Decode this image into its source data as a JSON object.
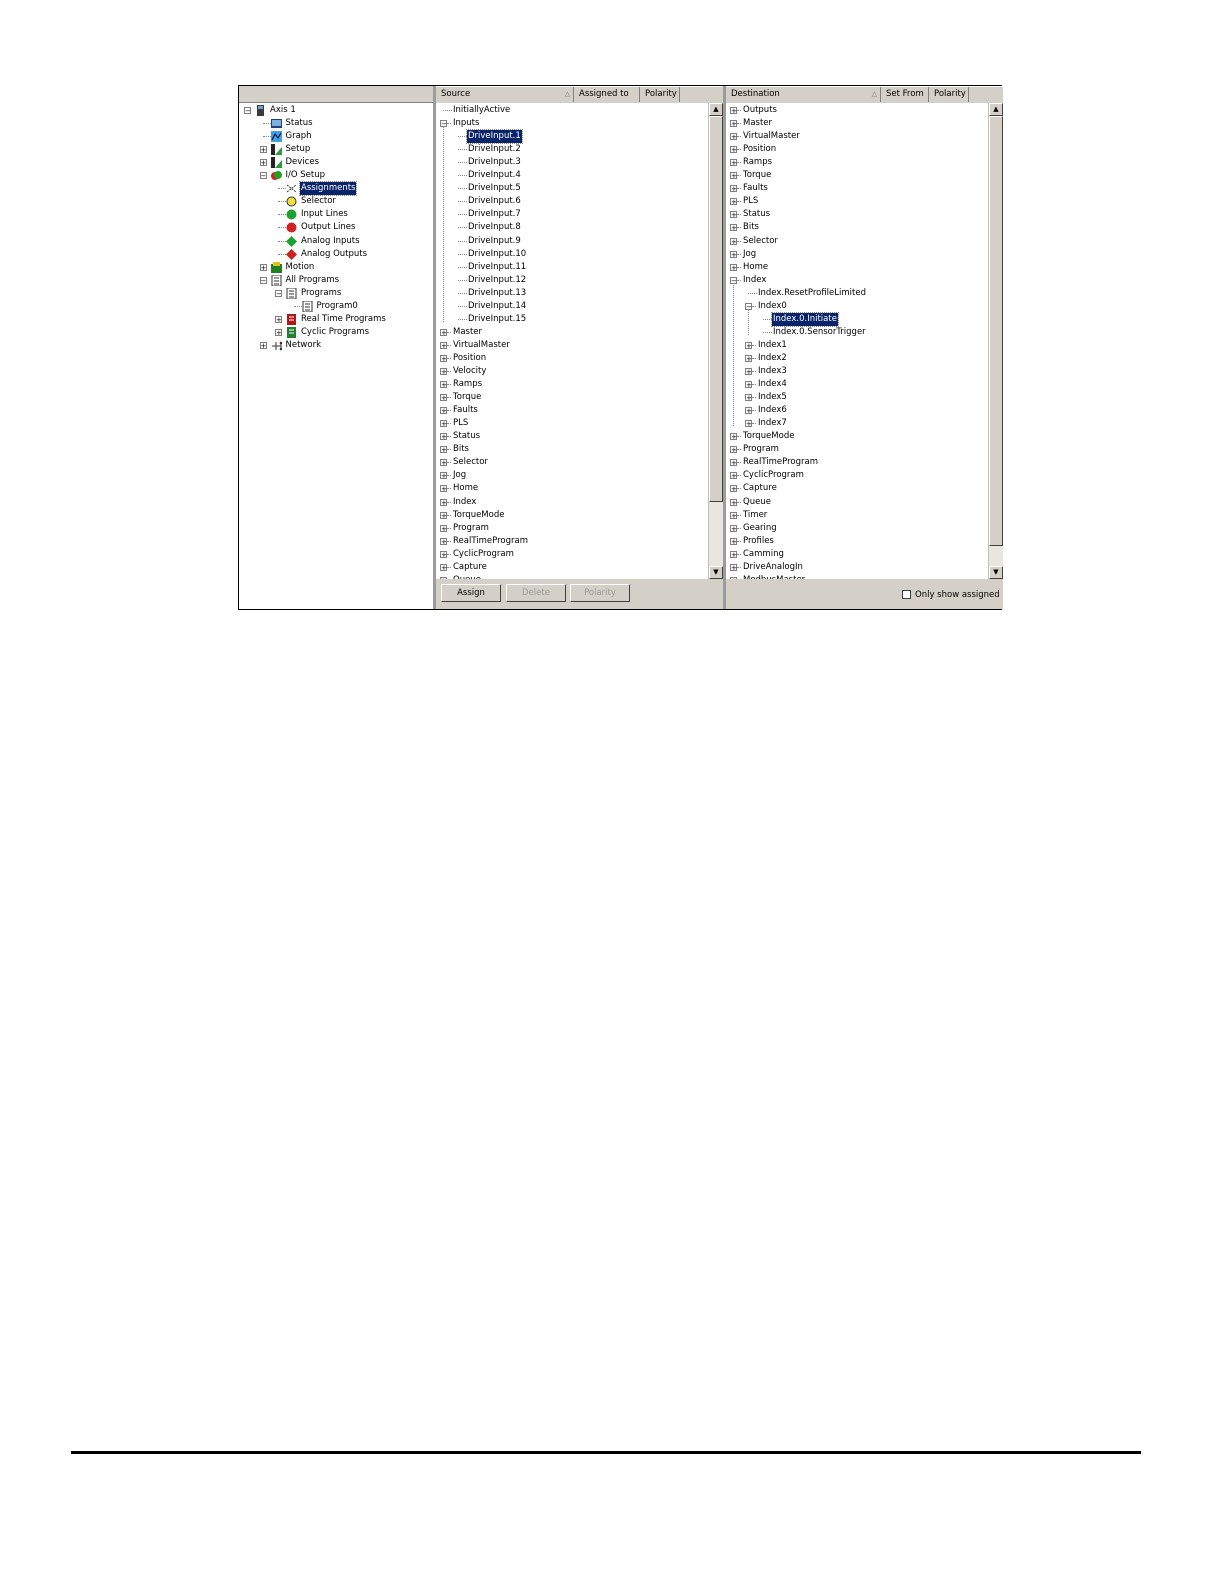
{
  "nav_tree": {
    "items": [
      {
        "label": "Axis 1",
        "icon": "axis-icon",
        "expander": "−"
      },
      {
        "label": "Status",
        "icon": "status-icon"
      },
      {
        "label": "Graph",
        "icon": "graph-icon"
      },
      {
        "label": "Setup",
        "icon": "setup-icon",
        "expander": "+"
      },
      {
        "label": "Devices",
        "icon": "devices-icon",
        "expander": "+"
      },
      {
        "label": "I/O Setup",
        "icon": "io-setup-icon",
        "expander": "−"
      },
      {
        "label": "Assignments",
        "icon": "assignments-icon",
        "selected": true
      },
      {
        "label": "Selector",
        "icon": "selector-icon"
      },
      {
        "label": "Input Lines",
        "icon": "input-lines-icon"
      },
      {
        "label": "Output Lines",
        "icon": "output-lines-icon"
      },
      {
        "label": "Analog Inputs",
        "icon": "analog-inputs-icon"
      },
      {
        "label": "Analog Outputs",
        "icon": "analog-outputs-icon"
      },
      {
        "label": "Motion",
        "icon": "motion-icon",
        "expander": "+"
      },
      {
        "label": "All Programs",
        "icon": "programs-icon",
        "expander": "−"
      },
      {
        "label": "Programs",
        "icon": "programs-icon",
        "expander": "−"
      },
      {
        "label": "Program0",
        "icon": "program-icon"
      },
      {
        "label": "Real Time Programs",
        "icon": "realtime-programs-icon",
        "expander": "+"
      },
      {
        "label": "Cyclic Programs",
        "icon": "cyclic-programs-icon",
        "expander": "+"
      },
      {
        "label": "Network",
        "icon": "network-icon",
        "expander": "+"
      }
    ]
  },
  "source": {
    "columns": [
      "Source",
      "Assigned to",
      "Polarity"
    ],
    "items": [
      {
        "label": "InitiallyActive"
      },
      {
        "label": "Inputs",
        "expander": "−"
      },
      {
        "label": "DriveInput.1",
        "selected": true
      },
      {
        "label": "DriveInput.2"
      },
      {
        "label": "DriveInput.3"
      },
      {
        "label": "DriveInput.4"
      },
      {
        "label": "DriveInput.5"
      },
      {
        "label": "DriveInput.6"
      },
      {
        "label": "DriveInput.7"
      },
      {
        "label": "DriveInput.8"
      },
      {
        "label": "DriveInput.9"
      },
      {
        "label": "DriveInput.10"
      },
      {
        "label": "DriveInput.11"
      },
      {
        "label": "DriveInput.12"
      },
      {
        "label": "DriveInput.13"
      },
      {
        "label": "DriveInput.14"
      },
      {
        "label": "DriveInput.15"
      },
      {
        "label": "Master",
        "expander": "+"
      },
      {
        "label": "VirtualMaster",
        "expander": "+"
      },
      {
        "label": "Position",
        "expander": "+"
      },
      {
        "label": "Velocity",
        "expander": "+"
      },
      {
        "label": "Ramps",
        "expander": "+"
      },
      {
        "label": "Torque",
        "expander": "+"
      },
      {
        "label": "Faults",
        "expander": "+"
      },
      {
        "label": "PLS",
        "expander": "+"
      },
      {
        "label": "Status",
        "expander": "+"
      },
      {
        "label": "Bits",
        "expander": "+"
      },
      {
        "label": "Selector",
        "expander": "+"
      },
      {
        "label": "Jog",
        "expander": "+"
      },
      {
        "label": "Home",
        "expander": "+"
      },
      {
        "label": "Index",
        "expander": "+"
      },
      {
        "label": "TorqueMode",
        "expander": "+"
      },
      {
        "label": "Program",
        "expander": "+"
      },
      {
        "label": "RealTimeProgram",
        "expander": "+"
      },
      {
        "label": "CyclicProgram",
        "expander": "+"
      },
      {
        "label": "Capture",
        "expander": "+"
      },
      {
        "label": "Queue",
        "expander": "+"
      }
    ],
    "buttons": {
      "assign": "Assign",
      "delete": "Delete",
      "polarity": "Polarity"
    }
  },
  "destination": {
    "columns": [
      "Destination",
      "Set From",
      "Polarity"
    ],
    "items": [
      {
        "label": "Outputs",
        "expander": "+"
      },
      {
        "label": "Master",
        "expander": "+"
      },
      {
        "label": "VirtualMaster",
        "expander": "+"
      },
      {
        "label": "Position",
        "expander": "+"
      },
      {
        "label": "Ramps",
        "expander": "+"
      },
      {
        "label": "Torque",
        "expander": "+"
      },
      {
        "label": "Faults",
        "expander": "+"
      },
      {
        "label": "PLS",
        "expander": "+"
      },
      {
        "label": "Status",
        "expander": "+"
      },
      {
        "label": "Bits",
        "expander": "+"
      },
      {
        "label": "Selector",
        "expander": "+"
      },
      {
        "label": "Jog",
        "expander": "+"
      },
      {
        "label": "Home",
        "expander": "+"
      },
      {
        "label": "Index",
        "expander": "−"
      },
      {
        "label": "Index.ResetProfileLimited"
      },
      {
        "label": "Index0",
        "expander": "−"
      },
      {
        "label": "Index.0.Initiate",
        "selected": true
      },
      {
        "label": "Index.0.SensorTrigger"
      },
      {
        "label": "Index1",
        "expander": "+"
      },
      {
        "label": "Index2",
        "expander": "+"
      },
      {
        "label": "Index3",
        "expander": "+"
      },
      {
        "label": "Index4",
        "expander": "+"
      },
      {
        "label": "Index5",
        "expander": "+"
      },
      {
        "label": "Index6",
        "expander": "+"
      },
      {
        "label": "Index7",
        "expander": "+"
      },
      {
        "label": "TorqueMode",
        "expander": "+"
      },
      {
        "label": "Program",
        "expander": "+"
      },
      {
        "label": "RealTimeProgram",
        "expander": "+"
      },
      {
        "label": "CyclicProgram",
        "expander": "+"
      },
      {
        "label": "Capture",
        "expander": "+"
      },
      {
        "label": "Queue",
        "expander": "+"
      },
      {
        "label": "Timer",
        "expander": "+"
      },
      {
        "label": "Gearing",
        "expander": "+"
      },
      {
        "label": "Profiles",
        "expander": "+"
      },
      {
        "label": "Camming",
        "expander": "+"
      },
      {
        "label": "DriveAnalogIn",
        "expander": "+"
      },
      {
        "label": "ModbusMaster",
        "expander": "+"
      }
    ],
    "only_show_assigned_label": "Only show assigned",
    "only_show_assigned_checked": false
  },
  "colors": {
    "selection": "#0a246a",
    "chrome": "#d4d0c8"
  }
}
